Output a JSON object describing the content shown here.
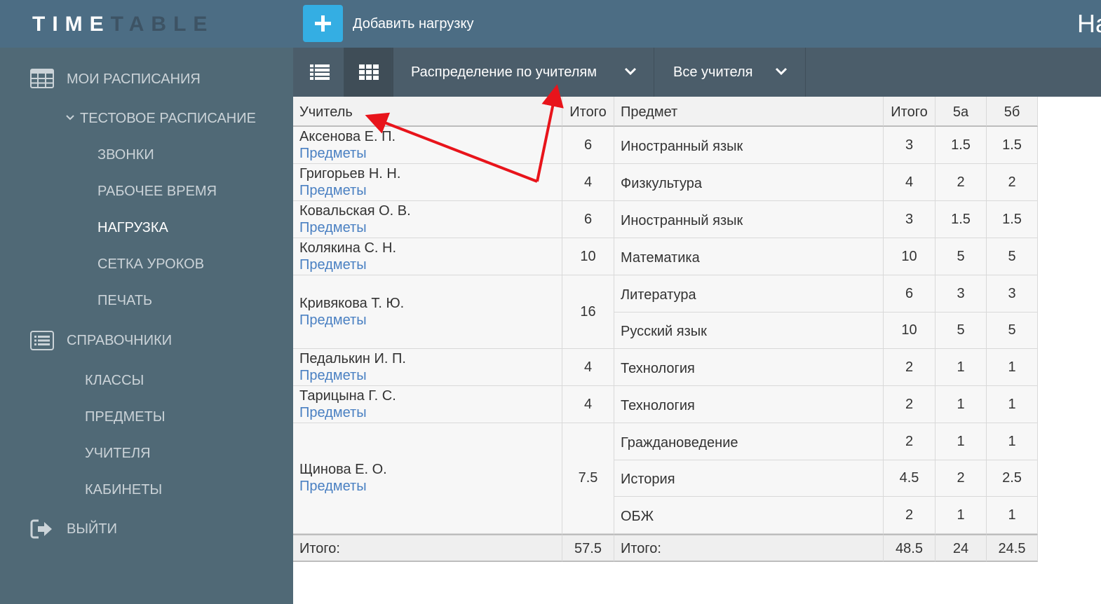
{
  "header": {
    "logo_part1": "TIME",
    "logo_part2": "TABLE",
    "add_button_label": "Добавить нагрузку",
    "right_text": "На"
  },
  "sidebar": {
    "my_schedules": "МОИ РАСПИСАНИЯ",
    "test_schedule": "ТЕСТОВОЕ РАСПИСАНИЕ",
    "schedule_items": [
      "ЗВОНКИ",
      "РАБОЧЕЕ ВРЕМЯ",
      "НАГРУЗКА",
      "СЕТКА УРОКОВ",
      "ПЕЧАТЬ"
    ],
    "references": "СПРАВОЧНИКИ",
    "reference_items": [
      "КЛАССЫ",
      "ПРЕДМЕТЫ",
      "УЧИТЕЛЯ",
      "КАБИНЕТЫ"
    ],
    "logout": "ВЫЙТИ"
  },
  "toolbar": {
    "distribution_dropdown": "Распределение по учителям",
    "teachers_dropdown": "Все учителя"
  },
  "table": {
    "headers": {
      "teacher": "Учитель",
      "teacher_total": "Итого",
      "subject": "Предмет",
      "subject_total": "Итого",
      "class_5a": "5а",
      "class_5b": "5б"
    },
    "link_label": "Предметы",
    "teachers": [
      {
        "name": "Аксенова Е. П.",
        "total": "6",
        "subjects": [
          {
            "name": "Иностранный язык",
            "total": "3",
            "c5a": "1.5",
            "c5b": "1.5"
          }
        ]
      },
      {
        "name": "Григорьев Н. Н.",
        "total": "4",
        "subjects": [
          {
            "name": "Физкультура",
            "total": "4",
            "c5a": "2",
            "c5b": "2"
          }
        ]
      },
      {
        "name": "Ковальская О. В.",
        "total": "6",
        "subjects": [
          {
            "name": "Иностранный язык",
            "total": "3",
            "c5a": "1.5",
            "c5b": "1.5"
          }
        ]
      },
      {
        "name": "Колякина С. Н.",
        "total": "10",
        "subjects": [
          {
            "name": "Математика",
            "total": "10",
            "c5a": "5",
            "c5b": "5"
          }
        ]
      },
      {
        "name": "Кривякова Т. Ю.",
        "total": "16",
        "subjects": [
          {
            "name": "Литература",
            "total": "6",
            "c5a": "3",
            "c5b": "3"
          },
          {
            "name": "Русский язык",
            "total": "10",
            "c5a": "5",
            "c5b": "5"
          }
        ]
      },
      {
        "name": "Педалькин И. П.",
        "total": "4",
        "subjects": [
          {
            "name": "Технология",
            "total": "2",
            "c5a": "1",
            "c5b": "1"
          }
        ]
      },
      {
        "name": "Тарицына Г. С.",
        "total": "4",
        "subjects": [
          {
            "name": "Технология",
            "total": "2",
            "c5a": "1",
            "c5b": "1"
          }
        ]
      },
      {
        "name": "Щинова Е. О.",
        "total": "7.5",
        "subjects": [
          {
            "name": "Граждановедение",
            "total": "2",
            "c5a": "1",
            "c5b": "1"
          },
          {
            "name": "История",
            "total": "4.5",
            "c5a": "2",
            "c5b": "2.5"
          },
          {
            "name": "ОБЖ",
            "total": "2",
            "c5a": "1",
            "c5b": "1"
          }
        ]
      }
    ],
    "footer": {
      "label_teachers": "Итого:",
      "teachers_total": "57.5",
      "label_subjects": "Итого:",
      "subjects_total": "48.5",
      "total_5a": "24",
      "total_5b": "24.5"
    }
  },
  "colors": {
    "header_bg": "#4c6d84",
    "sidebar_bg": "#506976",
    "toolbar_bg": "#4b5d6a",
    "add_button": "#34aee3",
    "link": "#4a80c2",
    "annotation_arrow": "#e8141b"
  },
  "icons": {
    "add": "plus-icon",
    "list_view": "list-view-icon",
    "grid_view": "grid-view-icon",
    "dropdown": "chevron-down-icon",
    "my_schedules": "table-grid-icon",
    "references": "list-card-icon",
    "logout": "logout-icon",
    "tree": "chevron-down-small-icon"
  }
}
